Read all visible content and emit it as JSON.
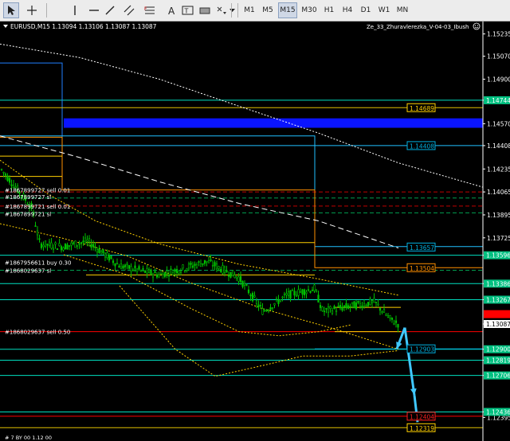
{
  "toolbar": {
    "timeframes": [
      "M1",
      "M5",
      "M15",
      "M30",
      "H1",
      "H4",
      "D1",
      "W1",
      "MN"
    ],
    "active_timeframe": "M15",
    "tools": [
      "cursor-icon",
      "crosshair-icon",
      "vertical-line-icon",
      "horizontal-line-icon",
      "trendline-icon",
      "channel-icon",
      "fibonacci-icon",
      "text-icon",
      "label-icon",
      "rectangle-icon",
      "arrow-mark-icon"
    ]
  },
  "chart": {
    "symbol": "EURUSD,M15",
    "ohlc": "1.13094 1.13106 1.13087 1.13087",
    "indicator": "Ze_33_Zhuravlerezka_V-04-03_Ibush",
    "price_min": 1.1225,
    "price_max": 1.1528,
    "colors": {
      "bull_candle": "#00c000",
      "bear_candle": "#00c000",
      "blue_zone": "#0a14ff",
      "cyan_line": "#00e0c0",
      "price_line": "#ff0000",
      "axis_text": "#ffffff"
    },
    "axis_ticks": [
      "1.15235",
      "1.15070",
      "1.14900",
      "1.14744",
      "1.14570",
      "1.14408",
      "1.14235",
      "1.14065",
      "1.13895",
      "1.13725",
      "1.13596",
      "1.13386",
      "1.13267",
      "1.13087",
      "1.12900",
      "1.12819",
      "1.12706",
      "1.12436",
      "1.12395"
    ],
    "axis_ticks_values": [
      1.15235,
      1.1507,
      1.149,
      1.14744,
      1.1457,
      1.14408,
      1.14235,
      1.14065,
      1.13895,
      1.13725,
      1.13596,
      1.13386,
      1.13267,
      1.13087,
      1.129,
      1.12819,
      1.12706,
      1.12436,
      1.12395
    ],
    "highlight_ticks": [
      {
        "label": "1.14744",
        "value": 1.14744,
        "bg": "#00c080",
        "fg": "#ffffff"
      },
      {
        "label": "1.13596",
        "value": 1.13596,
        "bg": "#00c080",
        "fg": "#ffffff"
      },
      {
        "label": "1.13386",
        "value": 1.13386,
        "bg": "#00c080",
        "fg": "#ffffff"
      },
      {
        "label": "1.13267",
        "value": 1.13267,
        "bg": "#00c080",
        "fg": "#ffffff"
      },
      {
        "label": "1.13087",
        "value": 1.13087,
        "bg": "#ffffff",
        "fg": "#000000"
      },
      {
        "label": "1.12900",
        "value": 1.129,
        "bg": "#00c080",
        "fg": "#ffffff"
      },
      {
        "label": "1.12819",
        "value": 1.12819,
        "bg": "#00c080",
        "fg": "#ffffff"
      },
      {
        "label": "1.12706",
        "value": 1.12706,
        "bg": "#00c080",
        "fg": "#ffffff"
      },
      {
        "label": "1.12436",
        "value": 1.12436,
        "bg": "#00c080",
        "fg": "#ffffff"
      }
    ],
    "price_labels": [
      {
        "text": "1.14689",
        "value": 1.14689,
        "color": "#ffd000"
      },
      {
        "text": "1.14408",
        "value": 1.14408,
        "color": "#00b0e0"
      },
      {
        "text": "1.13657",
        "value": 1.13657,
        "color": "#00b0e0"
      },
      {
        "text": "1.13504",
        "value": 1.13504,
        "color": "#ff9000"
      },
      {
        "text": "1.12903",
        "value": 1.12903,
        "color": "#00b0e0"
      },
      {
        "text": "1.12404",
        "value": 1.12404,
        "color": "#ff2020"
      },
      {
        "text": "1.12319",
        "value": 1.12319,
        "color": "#ffd000"
      }
    ],
    "order_labels": [
      {
        "text": "#1867899727 sell 0.01",
        "value": 1.1408
      },
      {
        "text": "#1867899727 sl",
        "value": 1.1403
      },
      {
        "text": "#1867899721 sell 0.01",
        "value": 1.1396
      },
      {
        "text": "#1867899721 sl",
        "value": 1.13905
      },
      {
        "text": "#1867956611 buy 0.30",
        "value": 1.13545
      },
      {
        "text": "#1868029637 sl",
        "value": 1.13485
      },
      {
        "text": "#1868029637 sell 0.50",
        "value": 1.1303
      }
    ],
    "bottom_text": "# 7 BY 00 1.12 00"
  }
}
